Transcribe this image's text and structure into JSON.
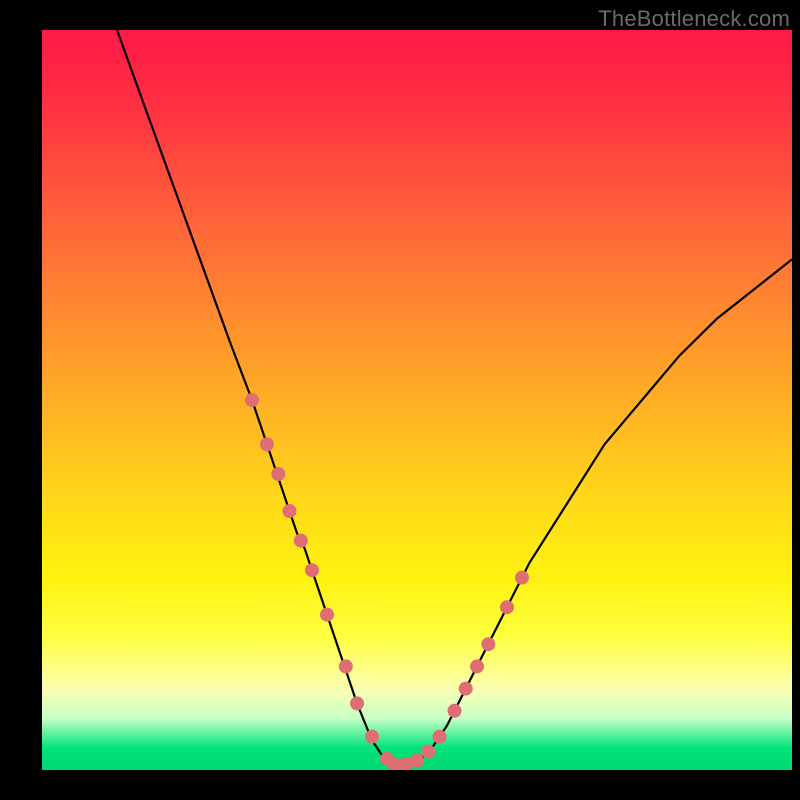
{
  "watermark": {
    "text": "TheBottleneck.com"
  },
  "colors": {
    "dot": "#de6e73",
    "line": "#000000",
    "gradient_top": "#ff1a46",
    "gradient_bottom": "#00d872",
    "frame": "#000000"
  },
  "chart_data": {
    "type": "line",
    "title": "",
    "xlabel": "",
    "ylabel": "",
    "xlim": [
      0,
      100
    ],
    "ylim": [
      0,
      100
    ],
    "grid": false,
    "legend": false,
    "note": "V-shaped bottleneck curve on rainbow gradient. y grows with distance from minimum near x≈47. Background hue encodes y (red high, green low). Values estimated from pixels.",
    "series": [
      {
        "name": "bottleneck-curve",
        "x": [
          10,
          15,
          20,
          25,
          28,
          30,
          32,
          34,
          35,
          36,
          38,
          40,
          42,
          44,
          46,
          48,
          50,
          52,
          54,
          56,
          58,
          60,
          62,
          65,
          70,
          75,
          80,
          85,
          90,
          95,
          100
        ],
        "y": [
          100,
          86,
          72,
          58,
          50,
          44,
          38,
          32,
          30,
          27,
          21,
          15,
          9,
          4,
          1,
          0.5,
          1,
          3,
          6,
          10,
          14,
          18,
          22,
          28,
          36,
          44,
          50,
          56,
          61,
          65,
          69
        ]
      }
    ],
    "dots": {
      "name": "highlight-points",
      "x": [
        28,
        30,
        31.5,
        33,
        34.5,
        36,
        38,
        40.5,
        42,
        44,
        46,
        47,
        48.5,
        50,
        51.5,
        53,
        55,
        56.5,
        58,
        59.5,
        62,
        64
      ],
      "y": [
        50,
        44,
        40,
        35,
        31,
        27,
        21,
        14,
        9,
        4.5,
        1.5,
        0.7,
        0.8,
        1.3,
        2.5,
        4.5,
        8,
        11,
        14,
        17,
        22,
        26
      ]
    }
  }
}
